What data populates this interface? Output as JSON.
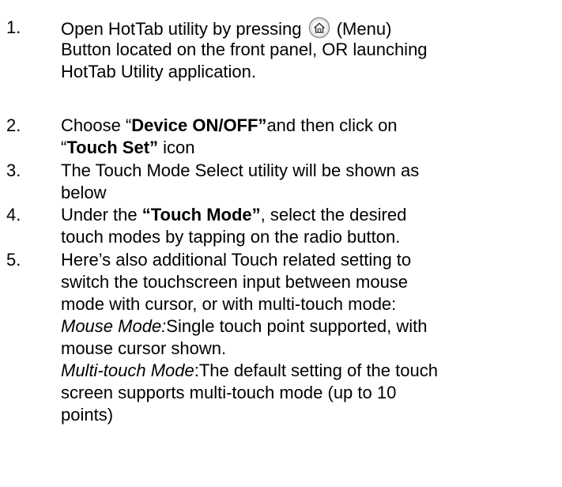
{
  "steps": [
    {
      "number": "1.",
      "line1_pre": "Open HotTab utility by pressing ",
      "line1_icon": "home-menu-icon",
      "line1_post": " (Menu)",
      "line2": "Button located on the front panel, OR launching",
      "line3": "HotTab Utility application."
    },
    {
      "number": "2.",
      "line1_pre": "Choose “",
      "line1_bold": "Device ON/OFF”",
      "line1_post": "and then click on",
      "line2_pre": "“",
      "line2_bold": "Touch Set”",
      "line2_post": " icon"
    },
    {
      "number": "3.",
      "line1": "The Touch Mode Select utility will be shown as",
      "line2": "below"
    },
    {
      "number": "4.",
      "line1_pre": "Under the ",
      "line1_bold": "“Touch Mode”",
      "line1_post": ", select the desired",
      "line2": "touch modes by tapping on the radio button."
    },
    {
      "number": "5.",
      "line1": "Here’s also additional Touch related setting to",
      "line2": "switch the touchscreen input between mouse",
      "line3": "mode with cursor, or with multi-touch mode:",
      "line4_italic": "Mouse Mode:",
      "line4_post": "Single touch point supported, with",
      "line5": "mouse cursor shown.",
      "line6_italic": "Multi-touch Mode",
      "line6_post": ":The default setting of the touch",
      "line7": "screen supports multi-touch mode (up to 10",
      "line8": "points)"
    }
  ]
}
